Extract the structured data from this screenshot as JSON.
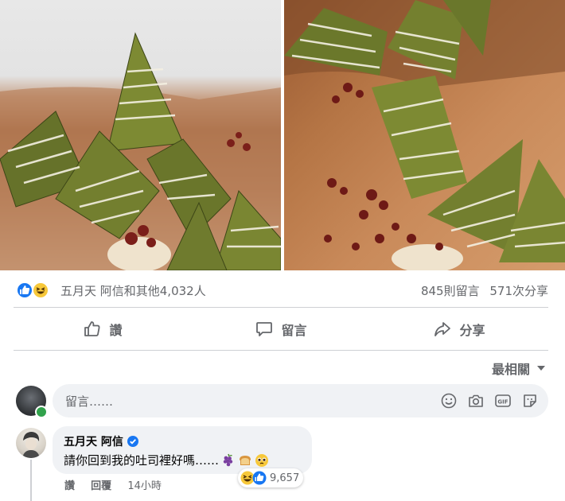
{
  "photos": [
    {
      "description_icon": "zongzi-photo-1"
    },
    {
      "description_icon": "zongzi-photo-2"
    }
  ],
  "reactions": {
    "icons": [
      "like-icon",
      "haha-icon"
    ],
    "summary": "五月天 阿信和其他4,032人",
    "comments_count": "845則留言",
    "shares_count": "571次分享"
  },
  "actions": {
    "like_label": "讚",
    "comment_label": "留言",
    "share_label": "分享"
  },
  "sort": {
    "label": "最相關"
  },
  "composer": {
    "placeholder": "留言……",
    "icons": [
      "emoji-icon",
      "camera-icon",
      "gif-icon",
      "sticker-icon"
    ]
  },
  "comment": {
    "author": "五月天 阿信",
    "verified": true,
    "text": "請你回到我的吐司裡好嗎……",
    "emojis": [
      "grapes-icon",
      "bread-icon",
      "pleading-face-icon"
    ],
    "reaction_count": "9,657",
    "like_label": "讚",
    "reply_label": "回覆",
    "time": "14小時"
  },
  "colors": {
    "facebook_blue": "#1877f2",
    "secondary_text": "#65676b",
    "divider": "#ced0d4",
    "input_bg": "#f0f2f5",
    "online_green": "#31a24c"
  }
}
